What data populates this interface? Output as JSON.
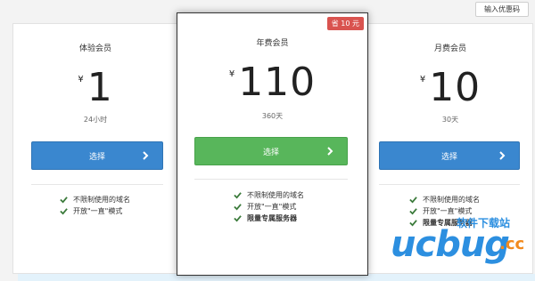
{
  "coupon_button": "输入优惠码",
  "colors": {
    "primary": "#3a87cf",
    "success": "#58b65b",
    "danger": "#d9534f",
    "check": "#3a7a3a"
  },
  "plans": [
    {
      "name": "体验会员",
      "currency": "¥",
      "price": "1",
      "duration": "24小时",
      "button": "选择",
      "features": [
        "不限制使用的域名",
        "开放\"一直\"模式"
      ]
    },
    {
      "name": "年费会员",
      "currency": "¥",
      "price": "110",
      "duration": "360天",
      "button": "选择",
      "badge": "省 10 元",
      "features": [
        "不限制使用的域名",
        "开放\"一直\"模式",
        "限量专属服务器"
      ]
    },
    {
      "name": "月费会员",
      "currency": "¥",
      "price": "10",
      "duration": "30天",
      "button": "选择",
      "features": [
        "不限制使用的域名",
        "开放\"一直\"模式",
        "限量专属服务器"
      ]
    }
  ],
  "watermark": {
    "main": "ucbug",
    "suffix": ".cc",
    "tagline": "软件下载站"
  }
}
